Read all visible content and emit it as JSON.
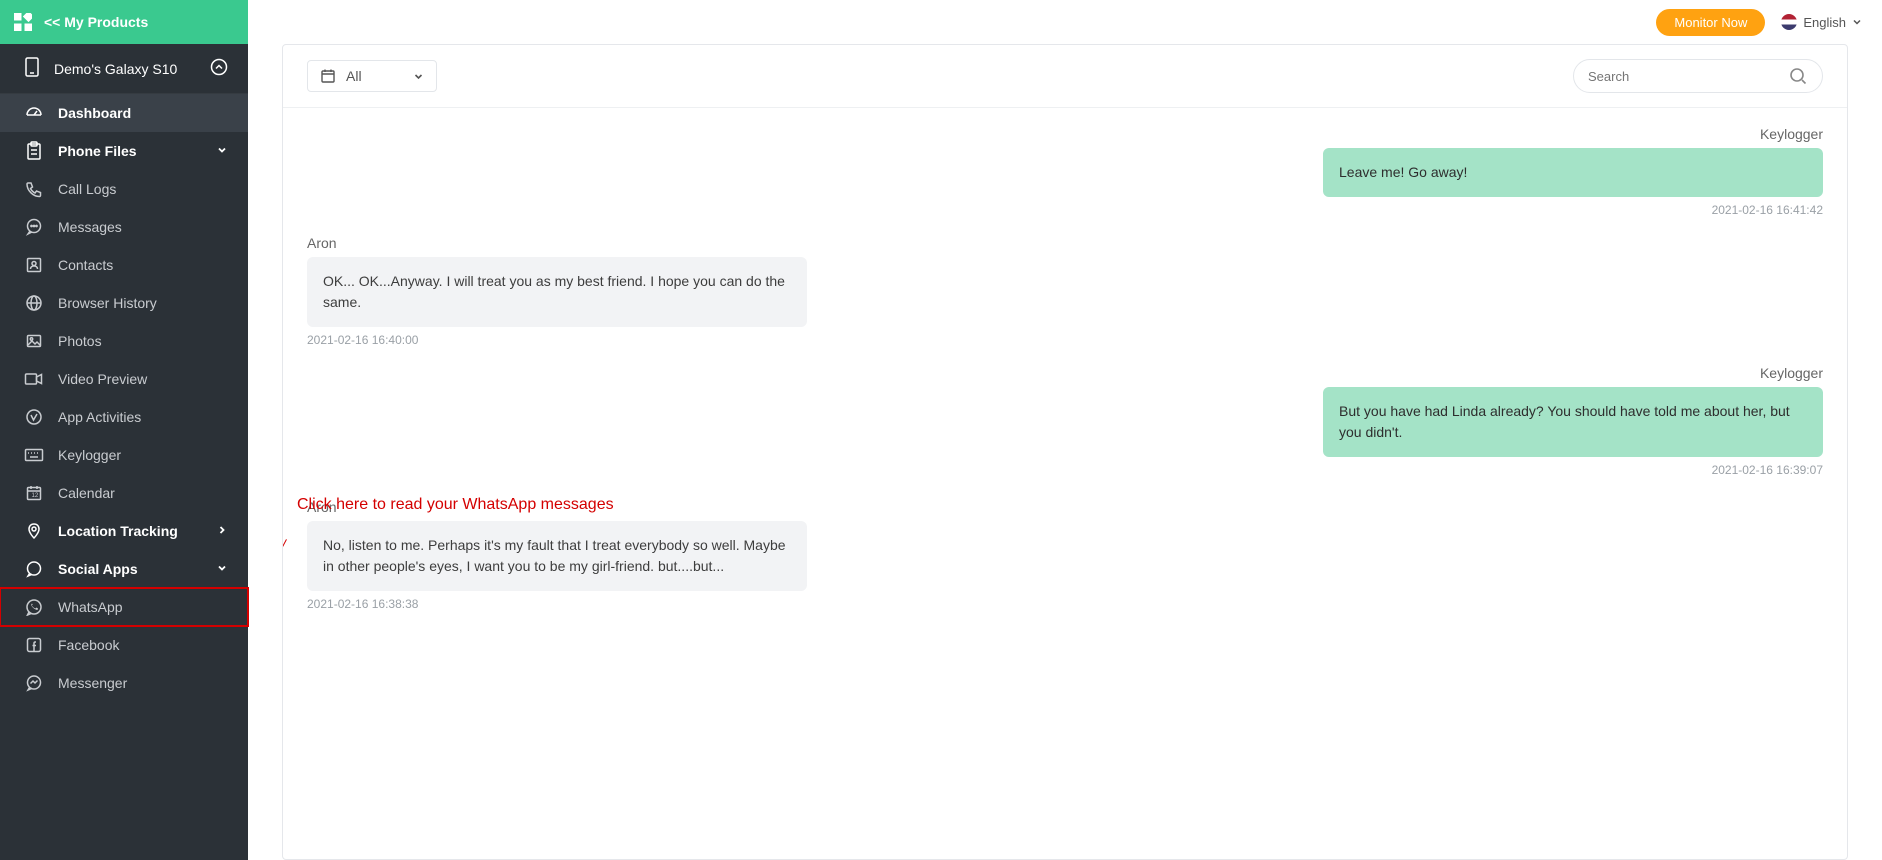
{
  "sidebar": {
    "top_label": "<<  My Products",
    "device_name": "Demo's Galaxy S10",
    "items": [
      {
        "label": "Dashboard"
      },
      {
        "label": "Phone Files"
      },
      {
        "label": "Call Logs"
      },
      {
        "label": "Messages"
      },
      {
        "label": "Contacts"
      },
      {
        "label": "Browser History"
      },
      {
        "label": "Photos"
      },
      {
        "label": "Video Preview"
      },
      {
        "label": "App Activities"
      },
      {
        "label": "Keylogger"
      },
      {
        "label": "Calendar"
      },
      {
        "label": "Location Tracking"
      },
      {
        "label": "Social Apps"
      },
      {
        "label": "WhatsApp"
      },
      {
        "label": "Facebook"
      },
      {
        "label": "Messenger"
      }
    ]
  },
  "topbar": {
    "monitor_label": "Monitor Now",
    "language": "English"
  },
  "filter": {
    "label": "All"
  },
  "search": {
    "placeholder": "Search"
  },
  "messages": [
    {
      "sender": "Keylogger",
      "side": "right",
      "text": "Leave me! Go away!",
      "ts": "2021-02-16 16:41:42"
    },
    {
      "sender": "Aron",
      "side": "left",
      "text": "OK... OK...Anyway. I will treat you as my best friend. I hope you can do the same.",
      "ts": "2021-02-16 16:40:00"
    },
    {
      "sender": "Keylogger",
      "side": "right",
      "text": "But you have had Linda already? You should have told me about her, but you didn't.",
      "ts": "2021-02-16 16:39:07"
    },
    {
      "sender": "Aron",
      "side": "left",
      "text": "No, listen to me. Perhaps it's my fault that I treat everybody so well. Maybe in other people's eyes, I want you to be my girl-friend. but....but...",
      "ts": "2021-02-16 16:38:38"
    }
  ],
  "annotation": "Click here to read your WhatsApp messages"
}
